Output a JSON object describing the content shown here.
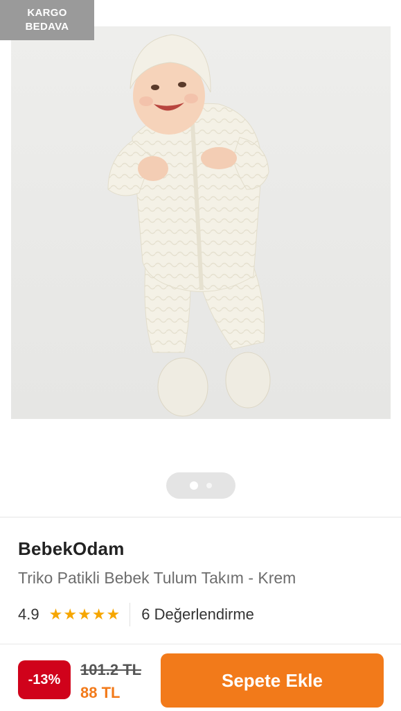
{
  "badge": {
    "line1": "KARGO",
    "line2": "BEDAVA"
  },
  "gallery": {
    "image_alt": "Triko Patikli Bebek Tulum Takım - Krem",
    "total_images": 2,
    "active_index": 0
  },
  "product": {
    "brand": "BebekOdam",
    "name": "Triko Patikli Bebek Tulum Takım - Krem",
    "rating": "4.9",
    "stars": 5,
    "review_label": "6 Değerlendirme"
  },
  "pricing": {
    "discount": "-13%",
    "old_price": "101.2 TL",
    "new_price": "88 TL"
  },
  "actions": {
    "add_to_cart": "Sepete Ekle"
  },
  "colors": {
    "accent": "#f27a1a",
    "discount": "#d0021b",
    "star": "#f6a600",
    "badge": "#9a9a9a"
  }
}
